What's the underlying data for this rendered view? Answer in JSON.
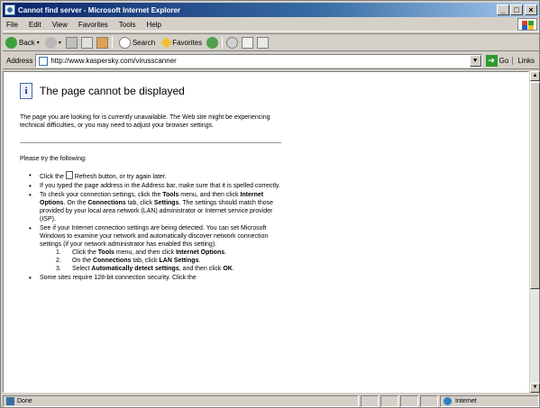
{
  "window": {
    "title": "Cannot find server - Microsoft Internet Explorer",
    "controls": {
      "minimize": "_",
      "maximize": "□",
      "close": "×"
    }
  },
  "menubar": {
    "items": [
      "File",
      "Edit",
      "View",
      "Favorites",
      "Tools",
      "Help"
    ]
  },
  "toolbar": {
    "back_label": "Back",
    "search_label": "Search",
    "favorites_label": "Favorites"
  },
  "address": {
    "label": "Address",
    "url": "http://www.kaspersky.com/virusscanner",
    "go_label": "Go",
    "links_label": "Links"
  },
  "page": {
    "info_glyph": "i",
    "title": "The page cannot be displayed",
    "description": "The page you are looking for is currently unavailable. The Web site might be experiencing technical difficulties, or you may need to adjust your browser settings.",
    "try_label": "Please try the following:",
    "tips": {
      "t1_pre": "Click the",
      "t1_post": "Refresh button, or try again later.",
      "t2": "If you typed the page address in the Address bar, make sure that it is spelled correctly.",
      "t3_a": "To check your connection settings, click the",
      "t3_tools": "Tools",
      "t3_b": "menu, and then click",
      "t3_options": "Internet Options",
      "t3_c": ". On the",
      "t3_connections": "Connections",
      "t3_d": "tab, click",
      "t3_settings": "Settings",
      "t3_e": ". The settings should match those provided by your local area network (LAN) administrator or Internet service provider (ISP).",
      "t4": "See if your Internet connection settings are being detected. You can set Microsoft Windows to examine your network and automatically discover network connection settings (if your network administrator has enabled this setting).",
      "s1_num": "1.",
      "s1_a": "Click the",
      "s1_tools": "Tools",
      "s1_b": "menu, and then click",
      "s1_options": "Internet Options",
      "s1_c": ".",
      "s2_num": "2.",
      "s2_a": "On the",
      "s2_connections": "Connections",
      "s2_b": "tab, click",
      "s2_lan": "LAN Settings",
      "s2_c": ".",
      "s3_num": "3.",
      "s3_a": "Select",
      "s3_auto": "Automatically detect settings",
      "s3_b": ", and then click",
      "s3_ok": "OK",
      "s3_c": ".",
      "t5": "Some sites require 128-bit connection security. Click the"
    }
  },
  "status": {
    "text": "Done",
    "zone": "Internet"
  },
  "colors": {
    "titlebar_start": "#0a246a",
    "titlebar_end": "#a6caf0",
    "chrome": "#d4d0c8"
  }
}
